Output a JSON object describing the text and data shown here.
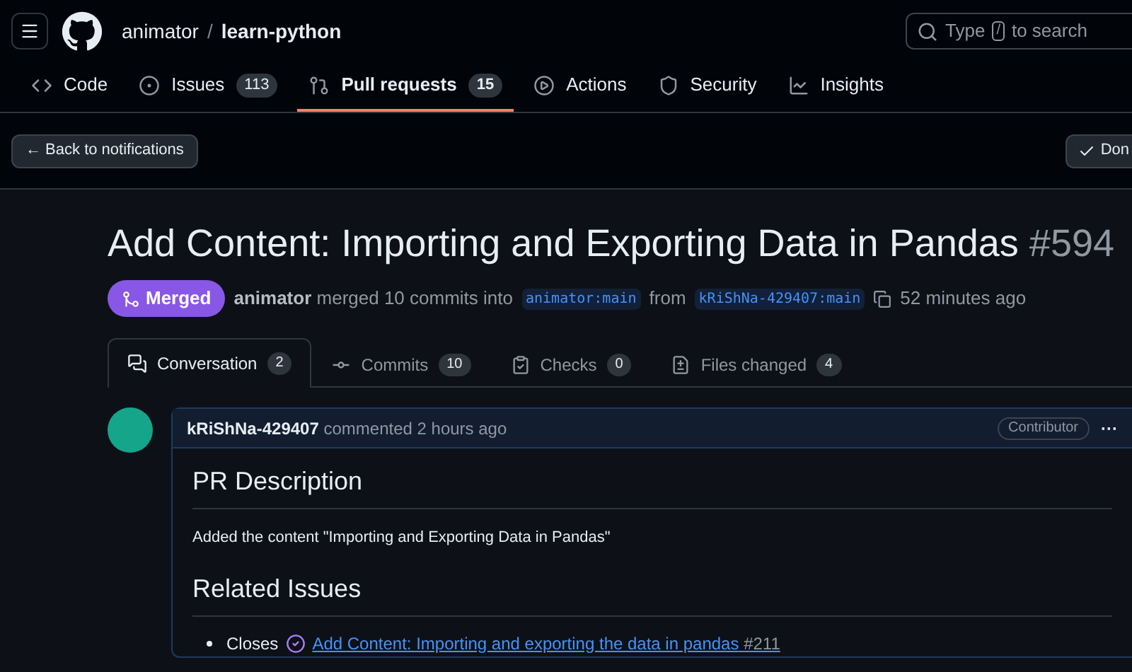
{
  "header": {
    "owner": "animator",
    "separator": "/",
    "repo": "learn-python",
    "search": {
      "placeholder_before": "Type",
      "key": "/",
      "placeholder_after": "to search"
    }
  },
  "repo_nav": [
    {
      "kind": "code",
      "label": "Code",
      "selected": false
    },
    {
      "kind": "issues",
      "label": "Issues",
      "count": "113",
      "selected": false
    },
    {
      "kind": "pulls",
      "label": "Pull requests",
      "count": "15",
      "selected": true
    },
    {
      "kind": "actions",
      "label": "Actions",
      "selected": false
    },
    {
      "kind": "security",
      "label": "Security",
      "selected": false
    },
    {
      "kind": "insights",
      "label": "Insights",
      "selected": false
    }
  ],
  "notification_bar": {
    "back": "← Back to notifications",
    "done": "Don"
  },
  "pull_request": {
    "title": "Add Content: Importing and Exporting Data in Pandas",
    "number": "#594",
    "state": "Merged",
    "author": "animator",
    "merged_text": "merged 10 commits into",
    "base": "animator:main",
    "from_text": "from",
    "head": "kRiShNa-429407:main",
    "time": "52 minutes ago"
  },
  "pr_tabs": [
    {
      "kind": "conversation",
      "label": "Conversation",
      "count": "2",
      "selected": true
    },
    {
      "kind": "commits",
      "label": "Commits",
      "count": "10",
      "selected": false
    },
    {
      "kind": "checks",
      "label": "Checks",
      "count": "0",
      "selected": false
    },
    {
      "kind": "files",
      "label": "Files changed",
      "count": "4",
      "selected": false
    }
  ],
  "comment": {
    "author": "kRiShNa-429407",
    "meta": "commented 2 hours ago",
    "badge": "Contributor",
    "menu": "···",
    "heading_1": "PR Description",
    "paragraph": "Added the content \"Importing and Exporting Data in Pandas\"",
    "heading_2": "Related Issues",
    "closes": {
      "label": "Closes",
      "link": "Add Content: Importing and exporting the data in pandas",
      "number": "#211"
    }
  }
}
